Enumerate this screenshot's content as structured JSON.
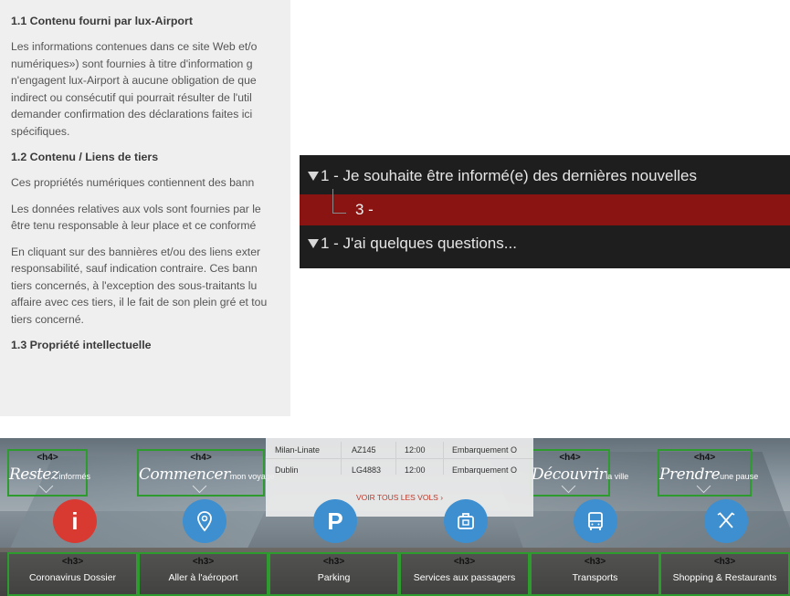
{
  "legal": {
    "s11_title": "1.1 Contenu fourni par lux-Airport",
    "s11_lines": [
      "Les informations contenues dans ce site Web et/o",
      "numériques») sont fournies à titre d'information g",
      "n'engagent lux-Airport à aucune obligation de que",
      "indirect ou consécutif qui pourrait résulter de l'util",
      "demander confirmation des déclarations faites ici",
      "spécifiques."
    ],
    "s12_title": "1.2 Contenu / Liens de tiers",
    "s12_p1": "Ces propriétés numériques contiennent des bann",
    "s12_p2_lines": [
      "Les données relatives aux vols sont fournies par le",
      "être tenu responsable à leur place et ce conformé"
    ],
    "s12_p3_lines": [
      "En cliquant sur des bannières et/ou des liens exter",
      "responsabilité, sauf indication contraire. Ces bann",
      "tiers concernés, à l'exception des sous-traitants lu",
      "affaire avec ces tiers, il le fait de son plein gré et tou",
      "tiers concerné."
    ],
    "s13_title": "1.3 Propriété intellectuelle"
  },
  "tree": {
    "row1": "1 - Je souhaite être informé(e) des dernières nouvelles",
    "row2": "3 -",
    "row3": "1 - J'ai quelques questions..."
  },
  "banner": {
    "h4_tag": "<h4>",
    "h3_tag": "<h3>",
    "h4": [
      {
        "script": "Restez",
        "small": "informés"
      },
      {
        "script": "Commencer",
        "small": "mon voyage"
      },
      {
        "script": "Découvrir",
        "small": "la ville"
      },
      {
        "script": "Prendre",
        "small": "une pause"
      }
    ],
    "circles": [
      {
        "icon": "info-icon",
        "color": "#d83a32",
        "glyph": "i"
      },
      {
        "icon": "location-pin-icon",
        "color": "#3d8fd0"
      },
      {
        "icon": "parking-icon",
        "color": "#3d8fd0",
        "glyph": "P"
      },
      {
        "icon": "luggage-icon",
        "color": "#3d8fd0"
      },
      {
        "icon": "bus-icon",
        "color": "#3d8fd0"
      },
      {
        "icon": "cutlery-icon",
        "color": "#3d8fd0"
      }
    ],
    "h3": [
      "Coronavirus Dossier",
      "Aller à l'aéroport",
      "Parking",
      "Services aux passagers",
      "Transports",
      "Shopping & Restaurants"
    ],
    "flights": [
      {
        "city": "Milan-Linate",
        "code": "AZ145",
        "time": "12:00",
        "status": "Embarquement O"
      },
      {
        "city": "Dublin",
        "code": "LG4883",
        "time": "12:00",
        "status": "Embarquement O"
      }
    ],
    "voir": "VOIR TOUS LES VOLS ›"
  }
}
